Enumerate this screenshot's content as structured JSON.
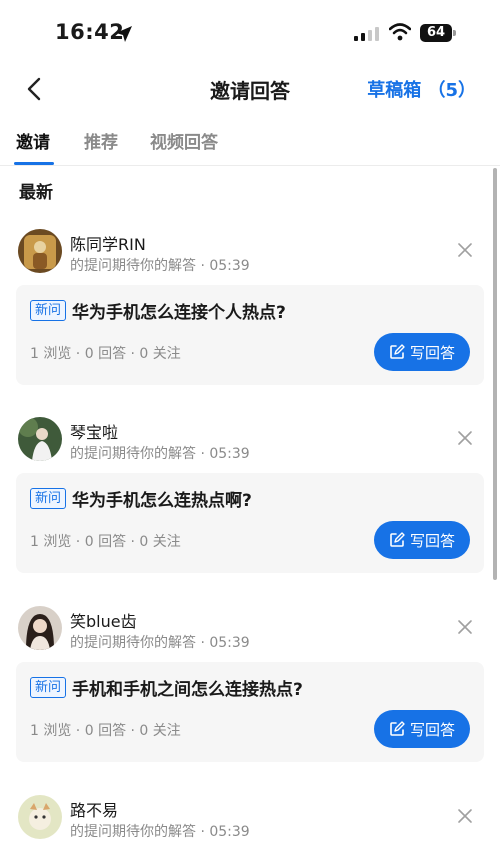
{
  "status": {
    "time": "16:42",
    "battery": "64"
  },
  "nav": {
    "title": "邀请回答",
    "drafts": "草稿箱 （5）"
  },
  "tabs": [
    {
      "label": "邀请",
      "active": true
    },
    {
      "label": "推荐",
      "active": false
    },
    {
      "label": "视频回答",
      "active": false
    }
  ],
  "section": {
    "title": "最新"
  },
  "items": [
    {
      "user": "陈同学RIN",
      "sub": "的提问期待你的解答 · 05:39",
      "badge": "新问",
      "question": "华为手机怎么连接个人热点?",
      "stats": "1 浏览 · 0 回答 · 0 关注",
      "button": "写回答"
    },
    {
      "user": "琴宝啦",
      "sub": "的提问期待你的解答 · 05:39",
      "badge": "新问",
      "question": "华为手机怎么连热点啊?",
      "stats": "1 浏览 · 0 回答 · 0 关注",
      "button": "写回答"
    },
    {
      "user": "笑blue齿",
      "sub": "的提问期待你的解答 · 05:39",
      "badge": "新问",
      "question": "手机和手机之间怎么连接热点?",
      "stats": "1 浏览 · 0 回答 · 0 关注",
      "button": "写回答"
    },
    {
      "user": "路不易",
      "sub": "的提问期待你的解答 · 05:39"
    }
  ],
  "colors": {
    "accent": "#1772e6",
    "muted": "#8a8a8a",
    "card": "#f6f6f6"
  }
}
